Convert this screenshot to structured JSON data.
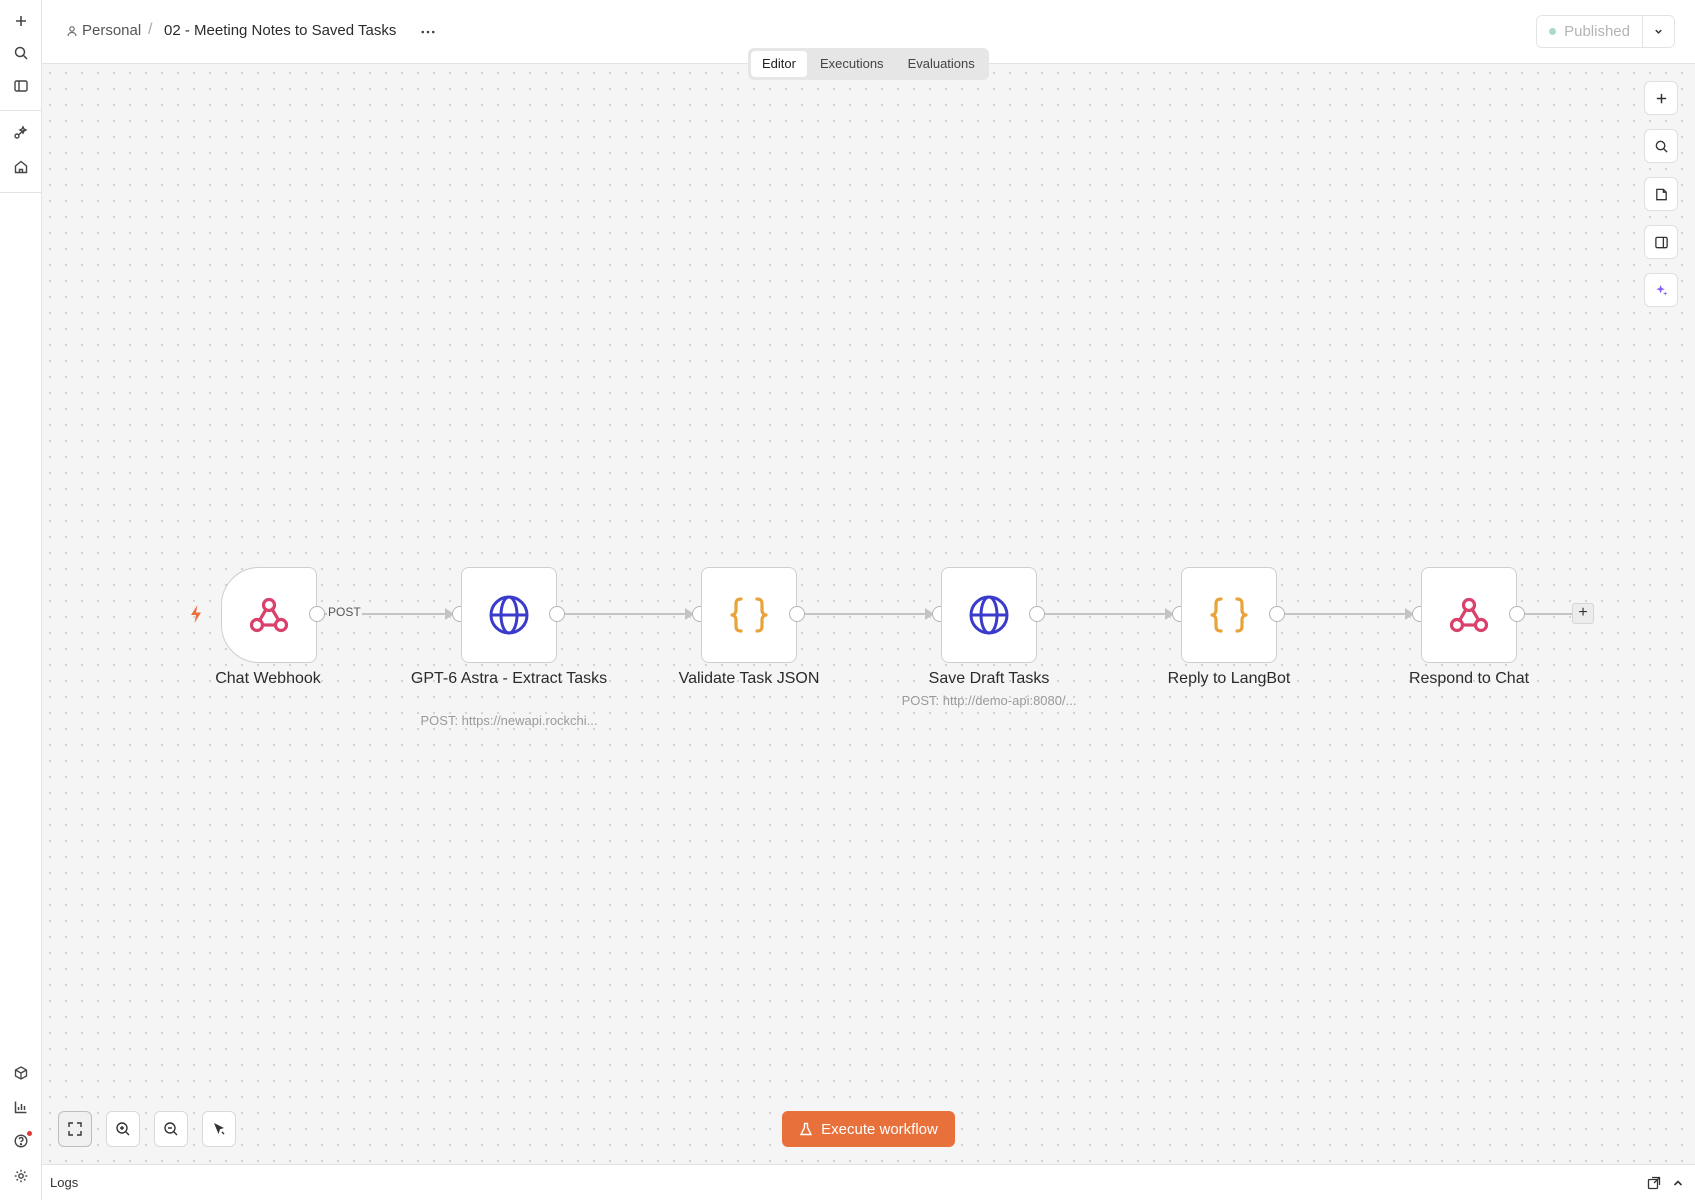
{
  "header": {
    "project": "Personal",
    "separator": "/",
    "workflow_title": "02 - Meeting Notes to Saved Tasks",
    "more": "···",
    "publish_label": "Published"
  },
  "tabs": [
    {
      "label": "Editor",
      "active": true
    },
    {
      "label": "Executions",
      "active": false
    },
    {
      "label": "Evaluations",
      "active": false
    }
  ],
  "workflow": {
    "connection_label": "POST",
    "nodes": [
      {
        "name": "Chat Webhook",
        "icon": "webhook-icon",
        "subtitle": ""
      },
      {
        "name": "GPT-6 Astra - Extract Tasks",
        "icon": "globe-icon",
        "subtitle": "POST: https://newapi.rockchi..."
      },
      {
        "name": "Validate Task JSON",
        "icon": "code-braces-icon",
        "subtitle": ""
      },
      {
        "name": "Save Draft Tasks",
        "icon": "globe-icon",
        "subtitle": "POST: http://demo-api:8080/..."
      },
      {
        "name": "Reply to LangBot",
        "icon": "code-braces-icon",
        "subtitle": ""
      },
      {
        "name": "Respond to Chat",
        "icon": "webhook-icon",
        "subtitle": ""
      }
    ],
    "add_node": "+"
  },
  "execute": {
    "label": "Execute workflow"
  },
  "logs": {
    "label": "Logs"
  },
  "colors": {
    "accent": "#e8703a",
    "webhook": "#d9416b",
    "globe": "#3a3acc",
    "code": "#e8a33a"
  }
}
